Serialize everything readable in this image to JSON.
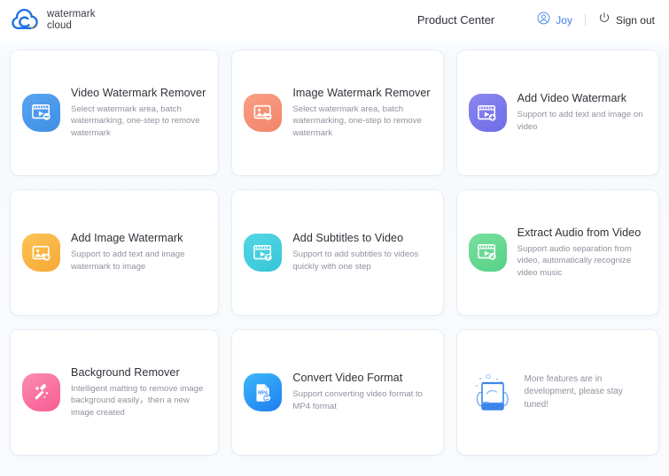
{
  "header": {
    "logo": {
      "icon": "cloud-swirl-logo-icon",
      "line1": "watermark",
      "line2": "cloud",
      "color": "#1f6fe5"
    },
    "product_center": "Product Center",
    "user": {
      "icon": "user-circle-icon",
      "name": "Joy",
      "color": "#3d7fe8"
    },
    "signout": {
      "icon": "power-icon",
      "label": "Sign out"
    }
  },
  "cards": [
    {
      "id": "video-watermark-remover",
      "title": "Video Watermark Remover",
      "desc": "Select watermark area, batch watermarking, one-step to remove watermark",
      "icon": "video-remove-watermark-icon",
      "color_from": "#5aa5f0",
      "color_to": "#3d8ee4"
    },
    {
      "id": "image-watermark-remover",
      "title": "Image Watermark Remover",
      "desc": "Select watermark area, batch watermarking, one-step to remove watermark",
      "icon": "image-remove-watermark-icon",
      "color_from": "#f99c7e",
      "color_to": "#f2836a"
    },
    {
      "id": "add-video-watermark",
      "title": "Add Video Watermark",
      "desc": "Support to add text and image on video",
      "icon": "video-add-watermark-icon",
      "color_from": "#8a87ef",
      "color_to": "#6f6ce8"
    },
    {
      "id": "add-image-watermark",
      "title": "Add Image Watermark",
      "desc": "Support to add text and image watermark to image",
      "icon": "image-add-watermark-icon",
      "color_from": "#fcbe4e",
      "color_to": "#f7a932"
    },
    {
      "id": "add-subtitles-to-video",
      "title": "Add Subtitles to Video",
      "desc": "Support to add subtitles to videos quickly with one step",
      "icon": "video-subtitles-icon",
      "color_from": "#50d3e0",
      "color_to": "#35c6d8"
    },
    {
      "id": "extract-audio-from-video",
      "title": "Extract Audio from Video",
      "desc": "Support audio separation from video, automatically recognize video music",
      "icon": "video-extract-audio-icon",
      "color_from": "#74dd9b",
      "color_to": "#55d186"
    },
    {
      "id": "background-remover",
      "title": "Background Remover",
      "desc": "Intelligent matting to remove image background easily，then a new image created",
      "icon": "magic-wand-icon",
      "color_from": "#fc77a6",
      "color_to": "#f75b93"
    },
    {
      "id": "convert-video-format",
      "title": "Convert Video Format",
      "desc": "Support converting video format to MP4 format",
      "icon": "mp4-file-icon",
      "color_from": "#39b6fb",
      "color_to": "#1f7df0"
    }
  ],
  "coming_soon": {
    "id": "more-features",
    "icon": "fish-tank-illustration-icon",
    "text": "More features are in development, please stay tuned!"
  }
}
